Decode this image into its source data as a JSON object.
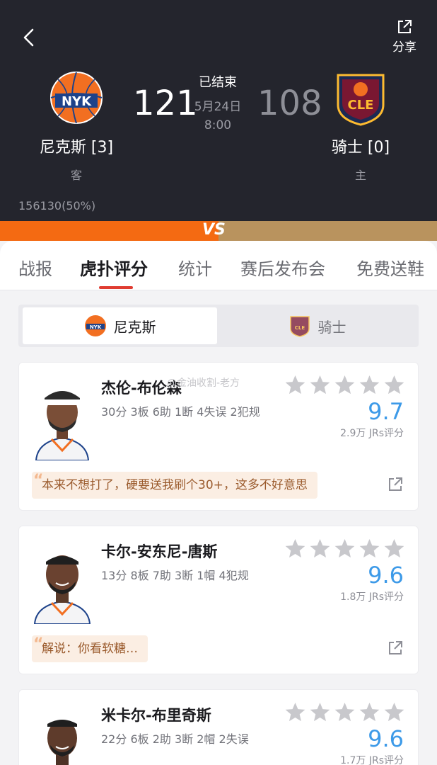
{
  "header": {
    "share_label": "分享",
    "status": "已结束",
    "date": "5月24日",
    "time": "8:00",
    "home": {
      "name": "尼克斯 [3]",
      "side": "客",
      "score": "121",
      "logo_text": "NYK",
      "color": "#f26f21"
    },
    "away": {
      "name": "骑士 [0]",
      "side": "主",
      "score": "108",
      "logo_text": "CLE",
      "color": "#7a1732"
    },
    "support_text": "156130(50%)"
  },
  "vs_label": "VS",
  "tabs": [
    "战报",
    "虎扑评分",
    "统计",
    "赛后发布会",
    "免费送鞋"
  ],
  "team_toggle": {
    "left_label": "尼克斯",
    "right_label": "骑士"
  },
  "players": [
    {
      "name": "杰伦-布伦森",
      "stats": "30分 3板 6助 1断 4失误 2犯规",
      "rating": "9.7",
      "votes": "2.9万 JRs评分",
      "comment": "本来不想打了，硬要送我刷个30+，这多不好意思"
    },
    {
      "name": "卡尔-安东尼-唐斯",
      "stats": "13分 8板 7助 3断 1帽 4犯规",
      "rating": "9.6",
      "votes": "1.8万 JRs评分",
      "comment": "解说：你看软糖…"
    },
    {
      "name": "米卡尔-布里奇斯",
      "stats": "22分 6板 2助 3断 2帽 2失误",
      "rating": "9.6",
      "votes": "1.7万 JRs评分",
      "comment": ""
    }
  ],
  "watermark": "@金油收割-老方",
  "colors": {
    "accent_red": "#e03c31",
    "rating_blue": "#3d9ae8",
    "vs_orange": "#f46a12",
    "vs_gold": "#b9935e"
  }
}
